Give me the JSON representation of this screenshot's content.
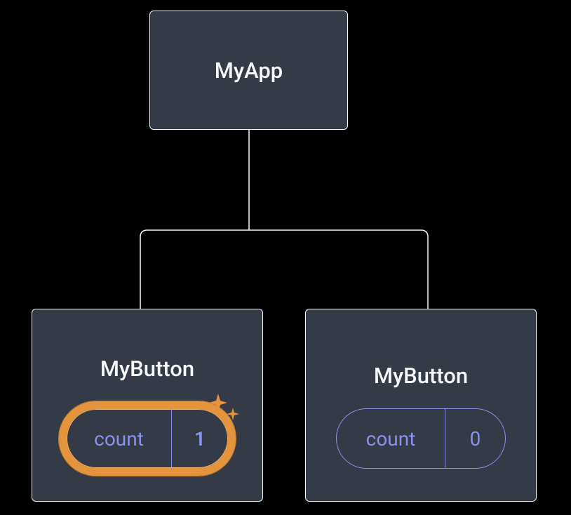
{
  "root": {
    "label": "MyApp"
  },
  "children": [
    {
      "label": "MyButton",
      "state_name": "count",
      "state_value": "1",
      "highlighted": true
    },
    {
      "label": "MyButton",
      "state_name": "count",
      "state_value": "0",
      "highlighted": false
    }
  ],
  "colors": {
    "node_bg": "#343a46",
    "node_border": "#f6f7f9",
    "pill_border": "#8891ec",
    "highlight": "#e5943e"
  }
}
